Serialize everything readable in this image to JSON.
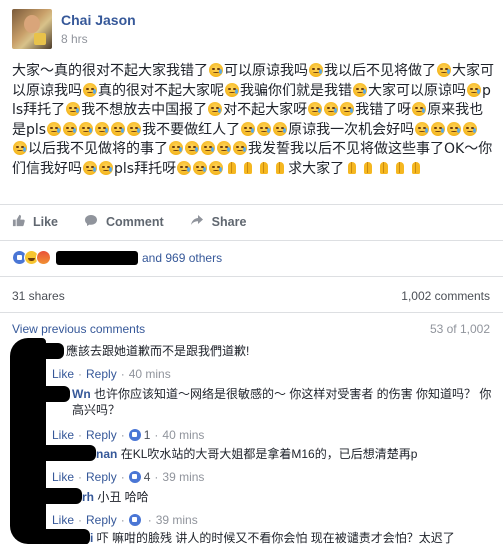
{
  "post": {
    "author": "Chai Jason",
    "time": "8 hrs",
    "segments": [
      "大家～真的很对不起大家我错了",
      "e",
      "可以原谅我吗",
      "e",
      "我以后不见将做了",
      "e",
      "大家可以原谅我吗",
      "e",
      "真的很对不起大家呢",
      "e",
      "我骗你们就是我错",
      "e",
      "大家可以原谅吗",
      "e",
      "pls拜托了",
      "e",
      "我不想放去中国报了",
      "e",
      "对不起大家呀",
      "e",
      "e",
      "e",
      "我错了呀",
      "e",
      "原来我也是pls",
      "e",
      "e",
      "e",
      "e",
      "e",
      "e",
      "我不要做红人了",
      "e",
      "e",
      "e",
      "原谅我一次机会好吗",
      "e",
      "e",
      "e",
      "e",
      "e",
      "以后我不见做将的事了",
      "e",
      "e",
      "e",
      "e",
      "e",
      "我发誓我以后不见将做这些事了OK～你们信我好吗",
      "e",
      "e",
      "pls拜托呀",
      "e",
      "e",
      "e",
      "p",
      "p",
      "p",
      "p",
      "求大家了",
      "p",
      "p",
      "p",
      "p",
      "p"
    ]
  },
  "actions": {
    "like_label": "Like",
    "comment_label": "Comment",
    "share_label": "Share"
  },
  "reactions": {
    "others_text": "and 969 others"
  },
  "stats": {
    "shares": "31 shares",
    "comments": "1,002 comments"
  },
  "view_previous": {
    "label": "View previous comments",
    "count": "53 of 1,002"
  },
  "comments": [
    {
      "name": "",
      "text": "應該去跟她道歉而不是跟我們道歉!",
      "like": "Like",
      "reply": "Reply",
      "likes": "",
      "time": "40 mins"
    },
    {
      "name": "Wn",
      "text": "也许你应该知道～网络是很敏感的～ 你这样对受害者 的伤害 你知道吗？ 你高兴吗？",
      "like": "Like",
      "reply": "Reply",
      "likes": "1",
      "time": "40 mins"
    },
    {
      "name": "nan",
      "text": "在KL吹水站的大哥大姐都是拿着M16的，已后想清楚再p",
      "like": "Like",
      "reply": "Reply",
      "likes": "4",
      "time": "39 mins"
    },
    {
      "name": "rh",
      "text": "小丑 哈哈",
      "like": "Like",
      "reply": "Reply",
      "likes": "",
      "time": "39 mins"
    },
    {
      "name": "i",
      "text": "吓 嘛咁的臉残 讲人的时候又不看你会怕 现在被谴责才会怕？太迟了",
      "like": "",
      "reply": "",
      "likes": "",
      "time": ""
    }
  ],
  "icons": {
    "like": "thumbs-up-icon",
    "comment": "speech-bubble-icon",
    "share": "share-arrow-icon"
  },
  "colors": {
    "link": "#365899",
    "muted": "#90949c",
    "text": "#1d2129",
    "like_blue": "#4a76d5"
  }
}
